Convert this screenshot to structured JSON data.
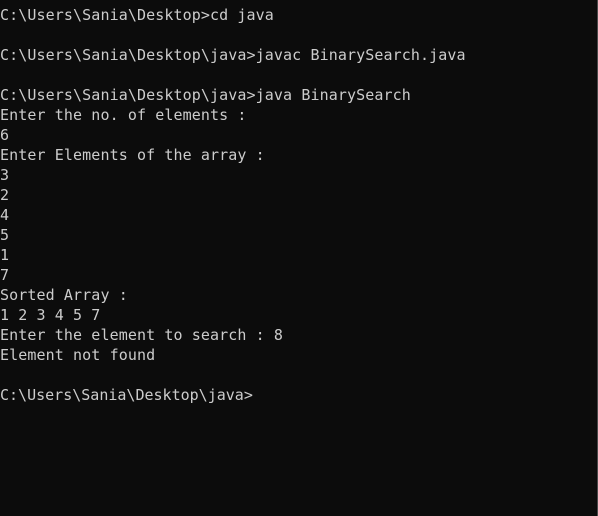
{
  "console": {
    "lines": [
      "C:\\Users\\Sania\\Desktop>cd java",
      "",
      "C:\\Users\\Sania\\Desktop\\java>javac BinarySearch.java",
      "",
      "C:\\Users\\Sania\\Desktop\\java>java BinarySearch",
      "Enter the no. of elements :",
      "6",
      "Enter Elements of the array :",
      "3",
      "2",
      "4",
      "5",
      "1",
      "7",
      "Sorted Array :",
      "1 2 3 4 5 7",
      "Enter the element to search : 8",
      "Element not found",
      "",
      "C:\\Users\\Sania\\Desktop\\java>"
    ]
  },
  "colors": {
    "background": "#0c0c0c",
    "text": "#cccccc"
  }
}
